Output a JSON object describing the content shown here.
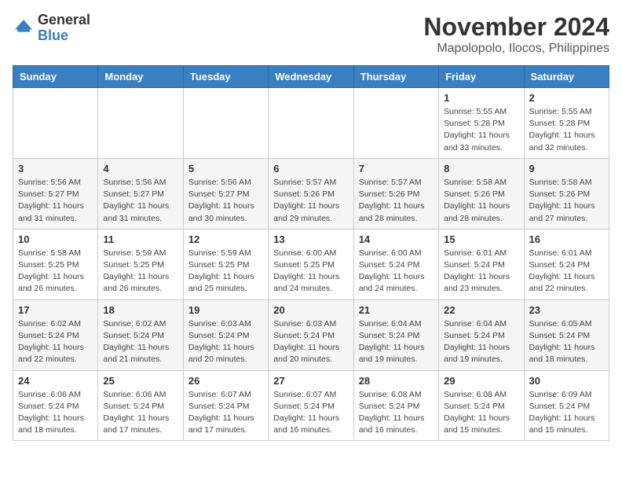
{
  "header": {
    "logo_general": "General",
    "logo_blue": "Blue",
    "month_title": "November 2024",
    "location": "Mapolopolo, Ilocos, Philippines"
  },
  "weekdays": [
    "Sunday",
    "Monday",
    "Tuesday",
    "Wednesday",
    "Thursday",
    "Friday",
    "Saturday"
  ],
  "weeks": [
    [
      {
        "day": "",
        "info": ""
      },
      {
        "day": "",
        "info": ""
      },
      {
        "day": "",
        "info": ""
      },
      {
        "day": "",
        "info": ""
      },
      {
        "day": "",
        "info": ""
      },
      {
        "day": "1",
        "info": "Sunrise: 5:55 AM\nSunset: 5:28 PM\nDaylight: 11 hours and 33 minutes."
      },
      {
        "day": "2",
        "info": "Sunrise: 5:55 AM\nSunset: 5:28 PM\nDaylight: 11 hours and 32 minutes."
      }
    ],
    [
      {
        "day": "3",
        "info": "Sunrise: 5:56 AM\nSunset: 5:27 PM\nDaylight: 11 hours and 31 minutes."
      },
      {
        "day": "4",
        "info": "Sunrise: 5:56 AM\nSunset: 5:27 PM\nDaylight: 11 hours and 31 minutes."
      },
      {
        "day": "5",
        "info": "Sunrise: 5:56 AM\nSunset: 5:27 PM\nDaylight: 11 hours and 30 minutes."
      },
      {
        "day": "6",
        "info": "Sunrise: 5:57 AM\nSunset: 5:26 PM\nDaylight: 11 hours and 29 minutes."
      },
      {
        "day": "7",
        "info": "Sunrise: 5:57 AM\nSunset: 5:26 PM\nDaylight: 11 hours and 28 minutes."
      },
      {
        "day": "8",
        "info": "Sunrise: 5:58 AM\nSunset: 5:26 PM\nDaylight: 11 hours and 28 minutes."
      },
      {
        "day": "9",
        "info": "Sunrise: 5:58 AM\nSunset: 5:26 PM\nDaylight: 11 hours and 27 minutes."
      }
    ],
    [
      {
        "day": "10",
        "info": "Sunrise: 5:58 AM\nSunset: 5:25 PM\nDaylight: 11 hours and 26 minutes."
      },
      {
        "day": "11",
        "info": "Sunrise: 5:59 AM\nSunset: 5:25 PM\nDaylight: 11 hours and 26 minutes."
      },
      {
        "day": "12",
        "info": "Sunrise: 5:59 AM\nSunset: 5:25 PM\nDaylight: 11 hours and 25 minutes."
      },
      {
        "day": "13",
        "info": "Sunrise: 6:00 AM\nSunset: 5:25 PM\nDaylight: 11 hours and 24 minutes."
      },
      {
        "day": "14",
        "info": "Sunrise: 6:00 AM\nSunset: 5:24 PM\nDaylight: 11 hours and 24 minutes."
      },
      {
        "day": "15",
        "info": "Sunrise: 6:01 AM\nSunset: 5:24 PM\nDaylight: 11 hours and 23 minutes."
      },
      {
        "day": "16",
        "info": "Sunrise: 6:01 AM\nSunset: 5:24 PM\nDaylight: 11 hours and 22 minutes."
      }
    ],
    [
      {
        "day": "17",
        "info": "Sunrise: 6:02 AM\nSunset: 5:24 PM\nDaylight: 11 hours and 22 minutes."
      },
      {
        "day": "18",
        "info": "Sunrise: 6:02 AM\nSunset: 5:24 PM\nDaylight: 11 hours and 21 minutes."
      },
      {
        "day": "19",
        "info": "Sunrise: 6:03 AM\nSunset: 5:24 PM\nDaylight: 11 hours and 20 minutes."
      },
      {
        "day": "20",
        "info": "Sunrise: 6:03 AM\nSunset: 5:24 PM\nDaylight: 11 hours and 20 minutes."
      },
      {
        "day": "21",
        "info": "Sunrise: 6:04 AM\nSunset: 5:24 PM\nDaylight: 11 hours and 19 minutes."
      },
      {
        "day": "22",
        "info": "Sunrise: 6:04 AM\nSunset: 5:24 PM\nDaylight: 11 hours and 19 minutes."
      },
      {
        "day": "23",
        "info": "Sunrise: 6:05 AM\nSunset: 5:24 PM\nDaylight: 11 hours and 18 minutes."
      }
    ],
    [
      {
        "day": "24",
        "info": "Sunrise: 6:06 AM\nSunset: 5:24 PM\nDaylight: 11 hours and 18 minutes."
      },
      {
        "day": "25",
        "info": "Sunrise: 6:06 AM\nSunset: 5:24 PM\nDaylight: 11 hours and 17 minutes."
      },
      {
        "day": "26",
        "info": "Sunrise: 6:07 AM\nSunset: 5:24 PM\nDaylight: 11 hours and 17 minutes."
      },
      {
        "day": "27",
        "info": "Sunrise: 6:07 AM\nSunset: 5:24 PM\nDaylight: 11 hours and 16 minutes."
      },
      {
        "day": "28",
        "info": "Sunrise: 6:08 AM\nSunset: 5:24 PM\nDaylight: 11 hours and 16 minutes."
      },
      {
        "day": "29",
        "info": "Sunrise: 6:08 AM\nSunset: 5:24 PM\nDaylight: 11 hours and 15 minutes."
      },
      {
        "day": "30",
        "info": "Sunrise: 6:09 AM\nSunset: 5:24 PM\nDaylight: 11 hours and 15 minutes."
      }
    ]
  ]
}
